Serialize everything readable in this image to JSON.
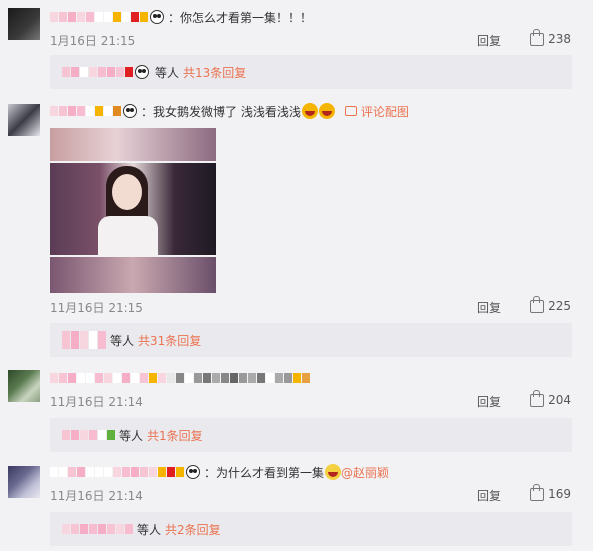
{
  "colors": {
    "accent": "#eb7350",
    "background": "#f2f2f5"
  },
  "comments": [
    {
      "text": "：你怎么才看第一集！！！",
      "time": "1月16日 21:15",
      "reply_label": "回复",
      "likes": "238",
      "sub": {
        "deng": "等人",
        "more": "共13条回复"
      }
    },
    {
      "text": "：我女鹅发微博了 浅浅看浅浅",
      "pic_link": "评论配图",
      "time": "11月16日 21:15",
      "reply_label": "回复",
      "likes": "225",
      "sub": {
        "deng": "等人",
        "more": "共31条回复"
      }
    },
    {
      "time": "11月16日 21:14",
      "reply_label": "回复",
      "likes": "204",
      "sub": {
        "deng": "等人",
        "more": "共1条回复"
      }
    },
    {
      "text": "：为什么才看到第一集",
      "mention": "@赵丽颖",
      "time": "11月16日 21:14",
      "reply_label": "回复",
      "likes": "169",
      "sub": {
        "deng": "等人",
        "more": "共2条回复"
      }
    }
  ]
}
